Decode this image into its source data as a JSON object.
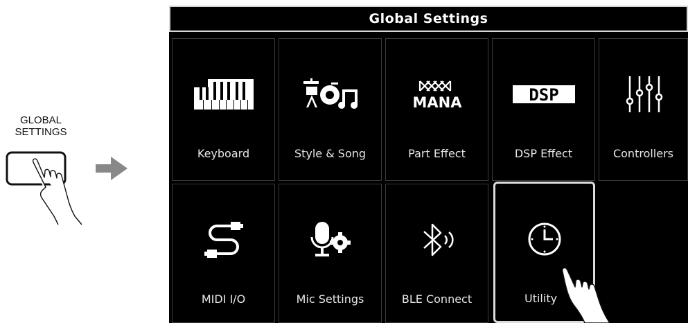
{
  "left_panel": {
    "line1": "GLOBAL",
    "line2": "SETTINGS"
  },
  "screen": {
    "title": "Global Settings",
    "tiles": [
      {
        "label": "Keyboard",
        "icon": "keyboard-icon"
      },
      {
        "label": "Style & Song",
        "icon": "style-song-icon"
      },
      {
        "label": "Part Effect",
        "icon": "mana-icon",
        "icon_text": "MANA"
      },
      {
        "label": "DSP Effect",
        "icon": "dsp-icon",
        "icon_text": "DSP"
      },
      {
        "label": "Controllers",
        "icon": "sliders-icon"
      },
      {
        "label": "MIDI I/O",
        "icon": "usb-cable-icon"
      },
      {
        "label": "Mic Settings",
        "icon": "mic-gear-icon"
      },
      {
        "label": "BLE Connect",
        "icon": "bluetooth-icon"
      },
      {
        "label": "Utility",
        "icon": "clock-icon",
        "selected": true
      }
    ]
  },
  "colors": {
    "screen_bg": "#000000",
    "text": "#e6e6e6",
    "highlight_border": "#dcdcdc"
  }
}
